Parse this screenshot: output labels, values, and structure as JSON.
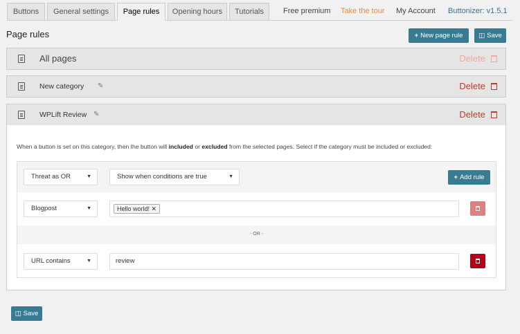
{
  "tabs": [
    {
      "label": "Buttons",
      "active": false
    },
    {
      "label": "General settings",
      "active": false
    },
    {
      "label": "Page rules",
      "active": true
    },
    {
      "label": "Opening hours",
      "active": false
    },
    {
      "label": "Tutorials",
      "active": false
    }
  ],
  "top_links": {
    "free_premium": "Free premium",
    "take_tour": "Take the tour",
    "my_account": "My Account",
    "version": "Buttonizer: v1.5.1"
  },
  "page": {
    "title": "Page rules",
    "new_rule_label": "New page rule",
    "save_label": "Save"
  },
  "rules": [
    {
      "name": "All pages",
      "delete_label": "Delete"
    },
    {
      "name": "New category",
      "delete_label": "Delete"
    },
    {
      "name": "WPLift Review",
      "delete_label": "Delete"
    }
  ],
  "expanded": {
    "desc_start": "When a button is set on this category, then the button will ",
    "desc_included": "included",
    "desc_or": " or ",
    "desc_excluded": "excluded",
    "desc_end": " from the selected pages. Select if the category must be included or excluded:",
    "logic_select": "Threat as OR",
    "show_select": "Show when conditions are true",
    "add_rule_label": "Add rule",
    "conditions": [
      {
        "type": "Blogpost",
        "tag": "Hello world!",
        "value": ""
      },
      {
        "type": "URL contains",
        "tag": "",
        "value": "review"
      }
    ],
    "separator": "- OR -"
  },
  "footer": {
    "save_label": "Save"
  },
  "colors": {
    "primary": "#3a7b94",
    "danger": "#c0392b",
    "danger_faded": "#e07f7f",
    "orange": "#f0873a"
  }
}
